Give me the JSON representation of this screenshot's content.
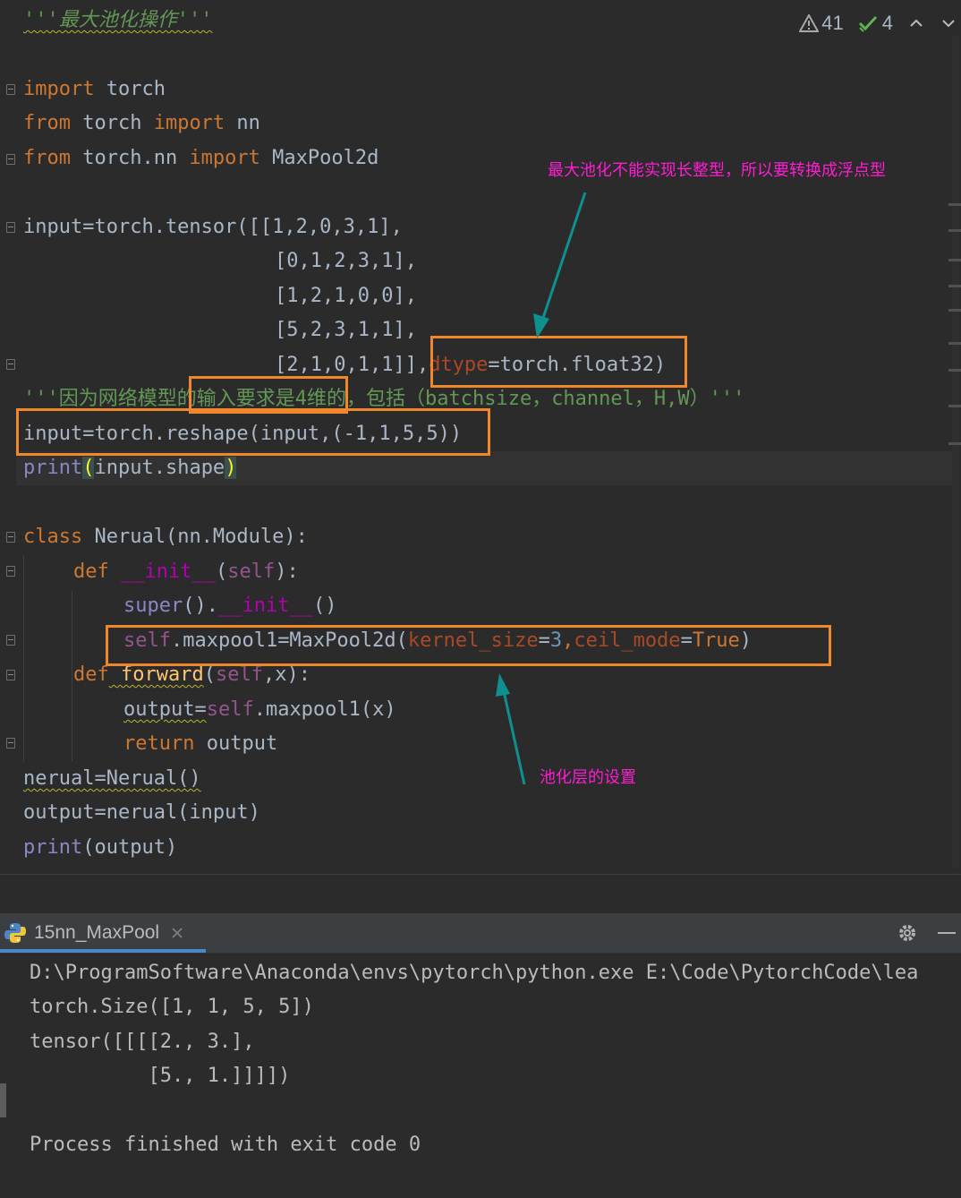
{
  "status": {
    "warnings": "41",
    "passes": "4"
  },
  "code": {
    "l1": "'''最大池化操作'''",
    "l3": [
      "import",
      " torch"
    ],
    "l4": [
      "from",
      " torch ",
      "import",
      " nn"
    ],
    "l5": [
      "from",
      " torch.nn ",
      "import",
      " MaxPool2d"
    ],
    "l7": "input=torch.tensor([[1,2,0,3,1],",
    "l8": "[0,1,2,3,1],",
    "l9": "[1,2,1,0,0],",
    "l10": "[5,2,3,1,1],",
    "l11a": "[2,1,0,1,1]],",
    "l11b": "dtype",
    "l11c": "=torch.float32)",
    "l12": "'''因为网络模型的输入要求是4维的，包括（batchsize，channel，H,W）'''",
    "l13": "input=torch.reshape(input,(-1,1,5,5))",
    "l14a": "print",
    "l14b": "(",
    "l14c": "input.shape",
    "l14d": ")",
    "l16a": "class",
    "l16b": " Nerual(nn.Module):",
    "l17a": "def",
    "l17b": " __init__",
    "l17c": "(",
    "l17d": "self",
    "l17e": "):",
    "l18a": "super",
    "l18b": "().",
    "l18c": "__init__",
    "l18d": "()",
    "l19a": "self",
    "l19b": ".maxpool1=MaxPool2d(",
    "l19c": "kernel_size",
    "l19d": "=",
    "l19e": "3",
    "l19f": ",",
    "l19g": "ceil_mode",
    "l19h": "=",
    "l19i": "True",
    "l19j": ")",
    "l20a": "def",
    "l20b": " forward",
    "l20c": "(",
    "l20d": "self",
    "l20e": ",x):",
    "l21a": "output=",
    "l21b": "self",
    "l21c": ".maxpool1(x)",
    "l22a": "return",
    "l22b": " output",
    "l23": "nerual=Nerual()",
    "l24": "output=nerual(input)",
    "l25a": "print",
    "l25b": "(output)"
  },
  "annotations": {
    "float_note": "最大池化不能实现长整型，所以要转换成浮点型",
    "pool_note": "池化层的设置"
  },
  "run_tab": {
    "label": "15nn_MaxPool"
  },
  "console": {
    "line1": "D:\\ProgramSoftware\\Anaconda\\envs\\pytorch\\python.exe E:\\Code\\PytorchCode\\lea",
    "line2": "torch.Size([1, 1, 5, 5])",
    "line3": "tensor([[[[2., 3.],",
    "line4": "          [5., 1.]]]])",
    "line5": "Process finished with exit code 0"
  }
}
